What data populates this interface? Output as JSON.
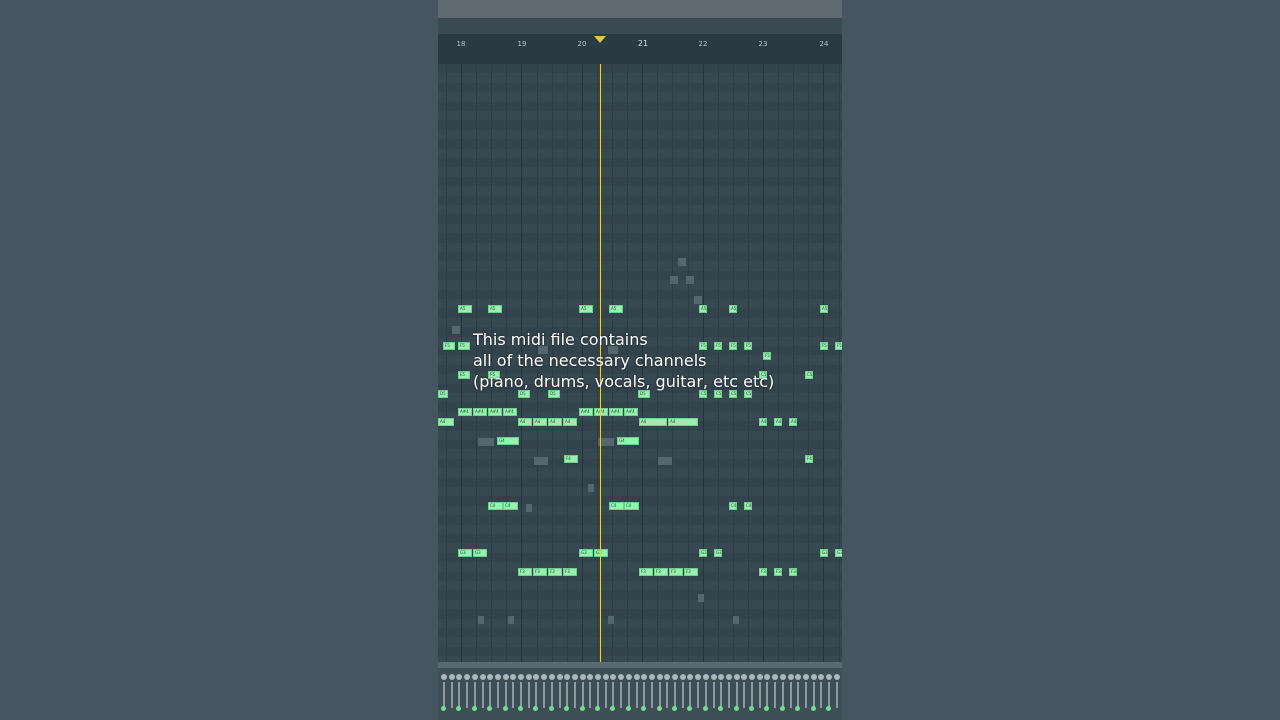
{
  "ruler": {
    "bars": [
      "18",
      "19",
      "20",
      "21",
      "22",
      "23",
      "24"
    ],
    "current_bar": "21"
  },
  "caption": {
    "lines": [
      "This midi file contains",
      "all of the necessary channels",
      "(piano, drums, vocals, guitar, etc etc)"
    ]
  },
  "colors": {
    "note": "#98f0b0",
    "playhead": "#e6d04a",
    "background": "#33444c"
  },
  "notes": [
    {
      "label": "A5"
    },
    {
      "label": "A5"
    },
    {
      "label": "A5"
    },
    {
      "label": "A5"
    },
    {
      "label": "A5"
    },
    {
      "label": "A5"
    },
    {
      "label": "A5"
    },
    {
      "label": "F5"
    },
    {
      "label": "F5"
    },
    {
      "label": "F5"
    },
    {
      "label": "F5"
    },
    {
      "label": "F5"
    },
    {
      "label": "F5"
    },
    {
      "label": "F5"
    },
    {
      "label": "F5"
    },
    {
      "label": "F5"
    },
    {
      "label": "E5"
    },
    {
      "label": "E5"
    },
    {
      "label": "D5"
    },
    {
      "label": "D5"
    },
    {
      "label": "D5"
    },
    {
      "label": "D5"
    },
    {
      "label": "C5"
    },
    {
      "label": "C5"
    },
    {
      "label": "C5"
    },
    {
      "label": "C5"
    },
    {
      "label": "C5"
    },
    {
      "label": "C5"
    },
    {
      "label": "A#4"
    },
    {
      "label": "A#4"
    },
    {
      "label": "A#4"
    },
    {
      "label": "A#4"
    },
    {
      "label": "A#4"
    },
    {
      "label": "A#4"
    },
    {
      "label": "A#4"
    },
    {
      "label": "A#4"
    },
    {
      "label": "A4"
    },
    {
      "label": "A4"
    },
    {
      "label": "A4"
    },
    {
      "label": "A4"
    },
    {
      "label": "A4"
    },
    {
      "label": "A4"
    },
    {
      "label": "A4"
    },
    {
      "label": "A4"
    },
    {
      "label": "A4"
    },
    {
      "label": "A4"
    },
    {
      "label": "G4"
    },
    {
      "label": "G4"
    },
    {
      "label": "F4"
    },
    {
      "label": "F4"
    },
    {
      "label": "C4"
    },
    {
      "label": "C4"
    },
    {
      "label": "C4"
    },
    {
      "label": "C4"
    },
    {
      "label": "C4"
    },
    {
      "label": "C4"
    },
    {
      "label": "G3"
    },
    {
      "label": "G3"
    },
    {
      "label": "G3"
    },
    {
      "label": "G3"
    },
    {
      "label": "G3"
    },
    {
      "label": "G3"
    },
    {
      "label": "G3"
    },
    {
      "label": "G3"
    },
    {
      "label": "F3"
    },
    {
      "label": "F3"
    },
    {
      "label": "F3"
    },
    {
      "label": "F3"
    },
    {
      "label": "F3"
    },
    {
      "label": "F3"
    },
    {
      "label": "F3"
    },
    {
      "label": "F3"
    },
    {
      "label": "F3"
    },
    {
      "label": "F3"
    },
    {
      "label": "F3"
    }
  ]
}
